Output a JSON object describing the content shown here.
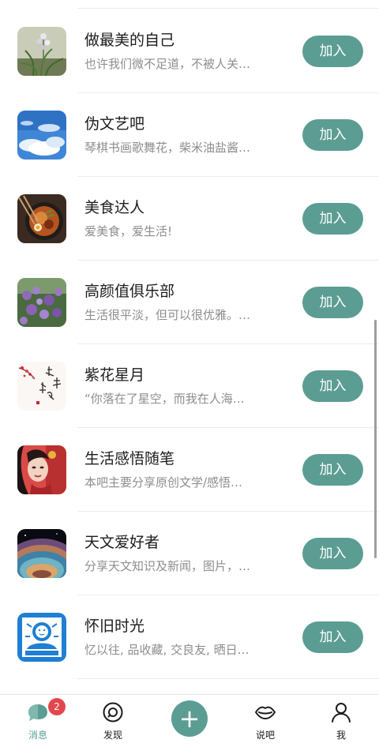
{
  "groups": [
    {
      "name": "做最美的自己",
      "desc": "也许我们微不足道，不被人关…",
      "join_label": "加入",
      "thumb": "orchid-plant-image"
    },
    {
      "name": "伪文艺吧",
      "desc": "琴棋书画歌舞花，柴米油盐酱…",
      "join_label": "加入",
      "thumb": "blue-sky-clouds-image"
    },
    {
      "name": "美食达人",
      "desc": "爱美食，爱生活!",
      "join_label": "加入",
      "thumb": "noodle-bowl-image"
    },
    {
      "name": "高颜值俱乐部",
      "desc": "生活很平淡，但可以很优雅。…",
      "join_label": "加入",
      "thumb": "purple-flowers-image"
    },
    {
      "name": "紫花星月",
      "desc": "“你落在了星空，而我在人海…",
      "join_label": "加入",
      "thumb": "calligraphy-plum-image"
    },
    {
      "name": "生活感悟随笔",
      "desc": "本吧主要分享原创文学/感悟…",
      "join_label": "加入",
      "thumb": "portrait-woman-image"
    },
    {
      "name": "天文爱好者",
      "desc": "分享天文知识及新闻，图片，…",
      "join_label": "加入",
      "thumb": "planet-surface-image"
    },
    {
      "name": "怀旧时光",
      "desc": "忆以往, 品收藏, 交良友, 晒日…",
      "join_label": "加入",
      "thumb": "retro-poster-image"
    }
  ],
  "tabbar": {
    "messages": {
      "label": "消息",
      "badge": "2",
      "icon": "chat-bubble-icon"
    },
    "discover": {
      "label": "发现",
      "icon": "compass-icon"
    },
    "post": {
      "label": "+",
      "icon": "plus-icon"
    },
    "talk": {
      "label": "说吧",
      "icon": "lips-icon"
    },
    "me": {
      "label": "我",
      "icon": "person-icon"
    }
  },
  "colors": {
    "accent": "#5c9d93",
    "badge": "#e2474b",
    "title_text": "#1c1c1c",
    "desc_text": "#8d8d8d"
  }
}
